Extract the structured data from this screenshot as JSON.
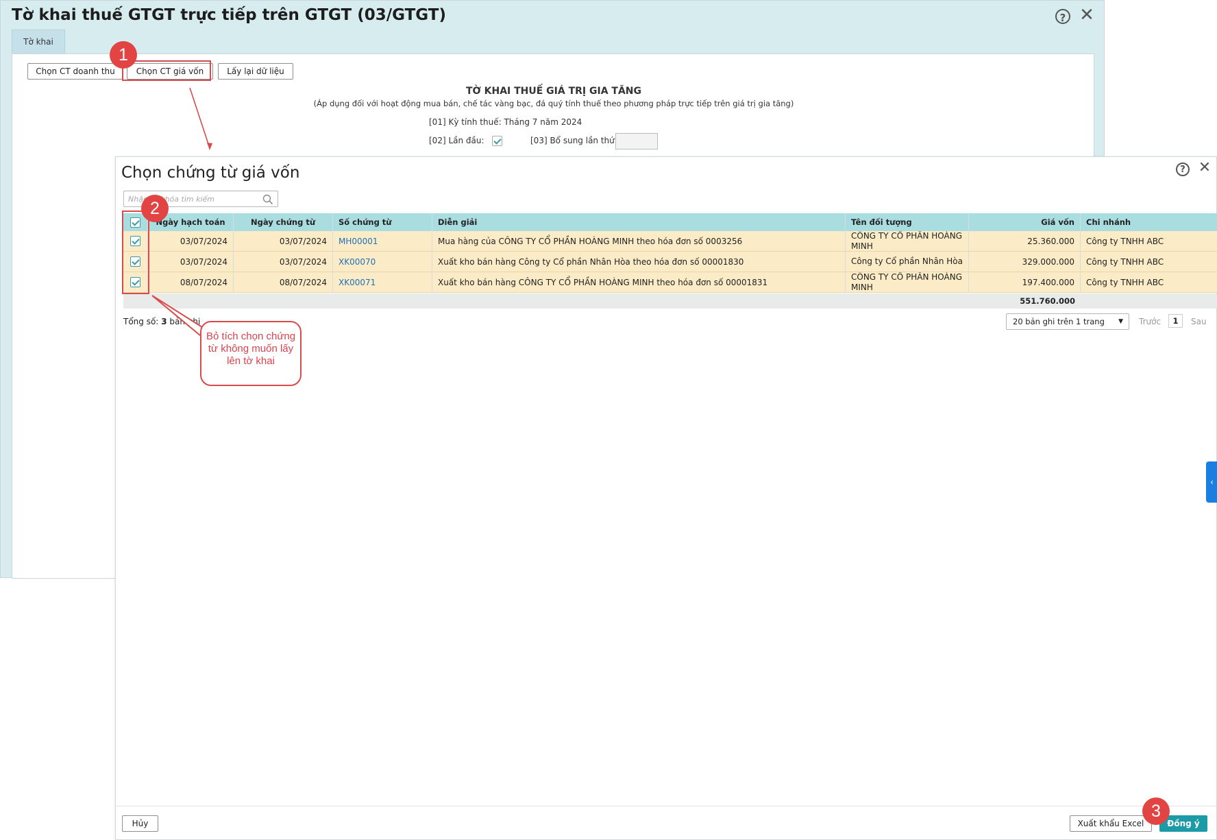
{
  "background_window": {
    "title": "Tờ khai thuế GTGT trực tiếp trên GTGT (03/GTGT)",
    "tab": "Tờ khai",
    "buttons": {
      "revenue": "Chọn CT doanh thu",
      "cost": "Chọn CT giá vốn",
      "reload": "Lấy lại dữ liệu"
    },
    "form_title": "TỜ KHAI THUẾ GIÁ TRỊ GIA TĂNG",
    "form_subtitle": "(Áp dụng đối với hoạt động mua bán, chế tác vàng bạc, đá quý tính thuế theo phương pháp trực tiếp trên giá trị gia tăng)",
    "tax_period": "[01] Kỳ tính thuế: Tháng 7 năm 2024",
    "first_time_label": "[02] Lần đầu:",
    "supplement_label": "[03] Bổ sung lần thứ:"
  },
  "dialog": {
    "title": "Chọn chứng từ giá vốn",
    "search_placeholder": "Nhập từ khóa tìm kiếm",
    "columns": [
      "Ngày hạch toán",
      "Ngày chứng từ",
      "Số chứng từ",
      "Diễn giải",
      "Tên đối tượng",
      "Giá vốn",
      "Chi nhánh"
    ],
    "rows": [
      {
        "posting_date": "03/07/2024",
        "doc_date": "03/07/2024",
        "doc_no": "MH00001",
        "desc": "Mua hàng của CÔNG TY CỔ PHẦN HOÀNG MINH theo hóa đơn số 0003256",
        "partner": "CÔNG TY CỔ PHẦN HOÀNG MINH",
        "cost": "25.360.000",
        "branch": "Công ty TNHH ABC"
      },
      {
        "posting_date": "03/07/2024",
        "doc_date": "03/07/2024",
        "doc_no": "XK00070",
        "desc": "Xuất kho bán hàng Công ty Cổ phần Nhân Hòa theo hóa đơn số 00001830",
        "partner": "Công ty Cổ phần Nhân Hòa",
        "cost": "329.000.000",
        "branch": "Công ty TNHH ABC"
      },
      {
        "posting_date": "08/07/2024",
        "doc_date": "08/07/2024",
        "doc_no": "XK00071",
        "desc": "Xuất kho bán hàng CÔNG TY CỔ PHẦN HOÀNG MINH theo hóa đơn số 00001831",
        "partner": "CÔNG TY CỔ PHẦN HOÀNG MINH",
        "cost": "197.400.000",
        "branch": "Công ty TNHH ABC"
      }
    ],
    "total_cost": "551.760.000",
    "total_label": "Tổng số:",
    "total_count": "3",
    "total_suffix": "bản ghi",
    "page_size": "20 bản ghi trên 1 trang",
    "prev": "Trước",
    "page": "1",
    "next": "Sau",
    "cancel": "Hủy",
    "export_excel": "Xuất khẩu Excel",
    "agree": "Đồng ý"
  },
  "annotations": {
    "step1": "1",
    "step2": "2",
    "step3": "3",
    "callout": "Bỏ tích chọn chứng từ không muốn lấy lên tờ khai"
  },
  "colors": {
    "header_bg": "#a9dde0",
    "row_bg": "#fbecc7",
    "primary": "#1c9aa7",
    "annotation_red": "#e24444",
    "link": "#1f6fb5"
  }
}
